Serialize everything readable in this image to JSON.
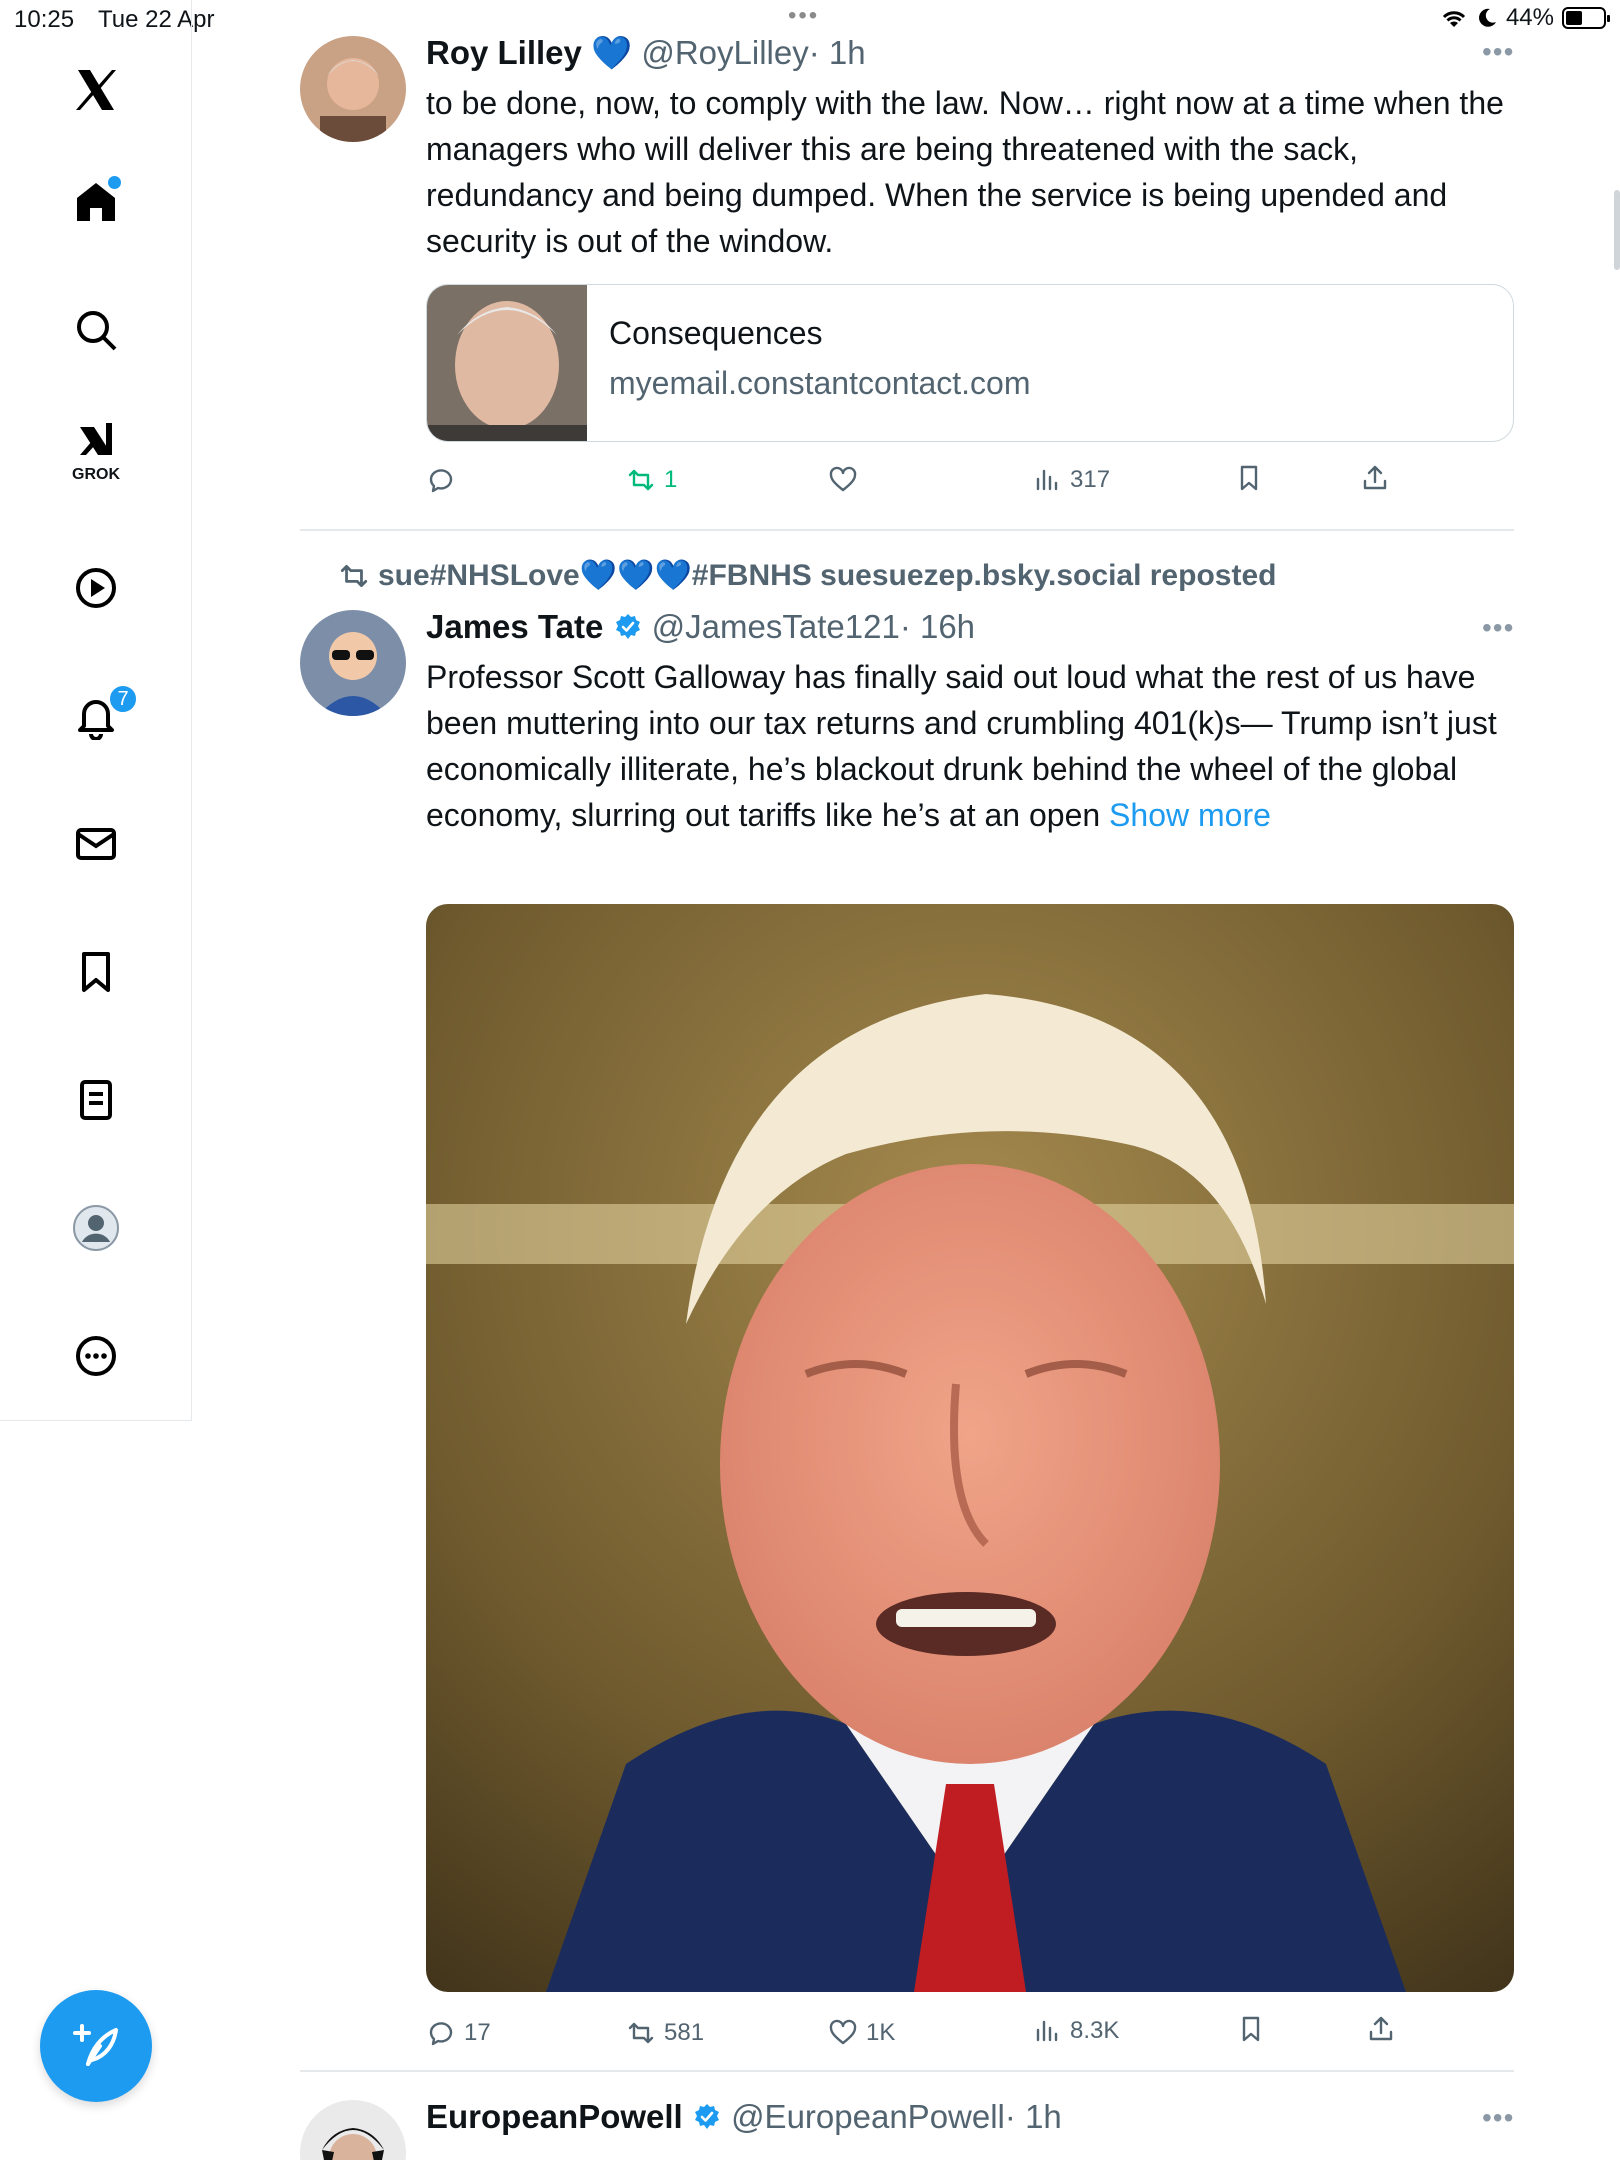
{
  "status_bar": {
    "time": "10:25",
    "date": "Tue 22 Apr",
    "battery": "44%"
  },
  "sidebar": {
    "items": [
      {
        "name": "x-logo"
      },
      {
        "name": "home"
      },
      {
        "name": "search"
      },
      {
        "name": "grok",
        "label": "GROK"
      },
      {
        "name": "video"
      },
      {
        "name": "notifications",
        "badge": "7"
      },
      {
        "name": "messages"
      },
      {
        "name": "bookmarks"
      },
      {
        "name": "lists"
      },
      {
        "name": "profile"
      },
      {
        "name": "more"
      }
    ]
  },
  "tweets": [
    {
      "name": "Roy Lilley",
      "handle": "@RoyLilley",
      "time": "· 1h",
      "text": "to be done, now, to comply with the law. Now… right now at a time when the managers who will deliver this are being threatened with the sack, redundancy and being dumped. When the service is being upended and security is out of the window.",
      "card": {
        "title": "Consequences",
        "domain": "myemail.constantcontact.com"
      },
      "actions": {
        "replies": "",
        "reposts": "1",
        "likes": "",
        "views": "317"
      }
    },
    {
      "repost_by": "sue#NHSLove💙💙💙#FBNHS suesuezep.bsky.social reposted",
      "name": "James Tate",
      "handle": "@JamesTate121",
      "time": "· 16h",
      "text": "Professor Scott Galloway has finally said out loud what the rest of us have been muttering into our tax returns and crumbling 401(k)s— Trump isn’t just economically illiterate, he’s blackout drunk behind the wheel of the global economy, slurring out tariffs like he’s at an open",
      "show_more": "Show more",
      "actions": {
        "replies": "17",
        "reposts": "581",
        "likes": "1K",
        "views": "8.3K"
      }
    },
    {
      "name": "EuropeanPowell",
      "handle": "@EuropeanPowell",
      "time": "· 1h"
    }
  ],
  "colors": {
    "accent": "#1d9bf0",
    "repost_green": "#00ba7c",
    "muted": "#536471"
  }
}
